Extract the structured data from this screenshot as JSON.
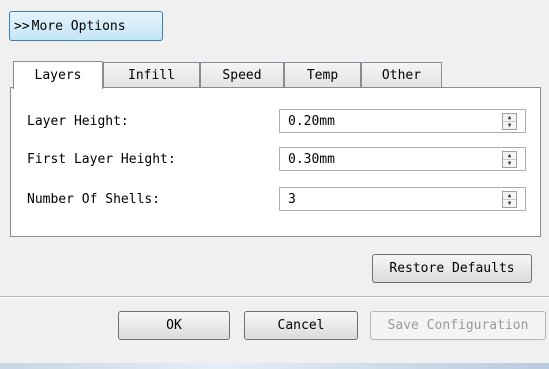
{
  "more_options": {
    "chevron": ">>",
    "label": "More Options"
  },
  "tabs": [
    {
      "label": "Layers",
      "active": true
    },
    {
      "label": "Infill",
      "active": false
    },
    {
      "label": "Speed",
      "active": false
    },
    {
      "label": "Temp",
      "active": false
    },
    {
      "label": "Other",
      "active": false
    }
  ],
  "fields": [
    {
      "label": "Layer Height:",
      "value": "0.20mm"
    },
    {
      "label": "First Layer Height:",
      "value": "0.30mm"
    },
    {
      "label": "Number Of Shells:",
      "value": "3"
    }
  ],
  "restore_defaults_label": "Restore Defaults",
  "footer": {
    "ok_label": "OK",
    "cancel_label": "Cancel",
    "save_label": "Save Configuration"
  }
}
